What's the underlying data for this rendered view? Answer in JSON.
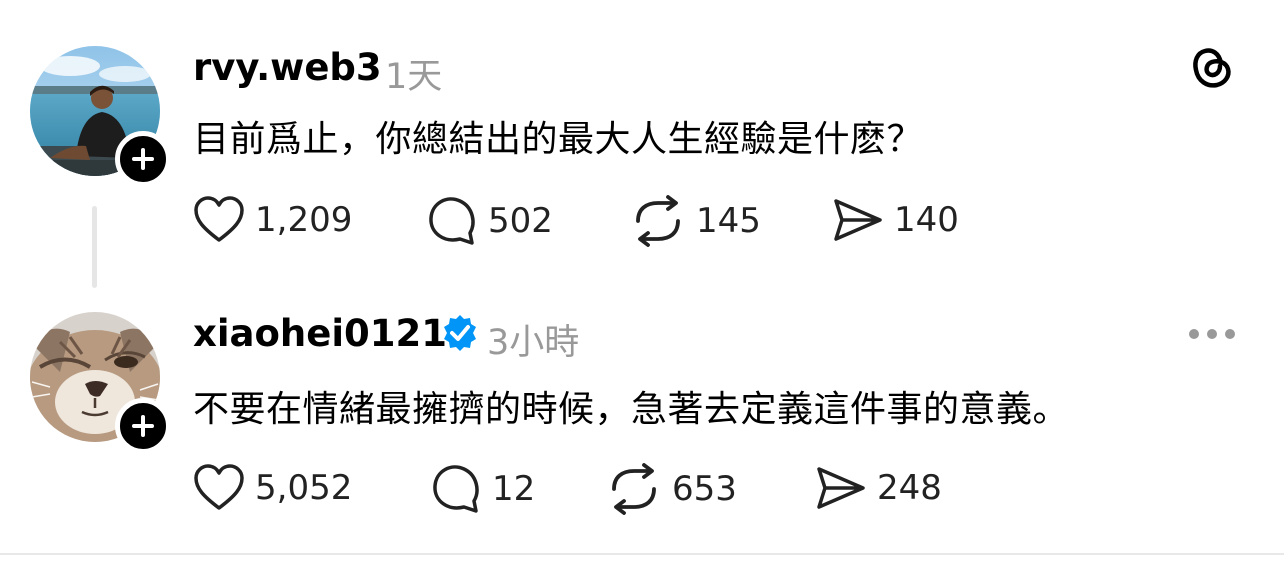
{
  "posts": [
    {
      "username": "rvy.web3",
      "time": "1天",
      "text": "目前爲止，你總結出的最大人生經驗是什麽？",
      "likes": "1,209",
      "replies": "502",
      "reposts": "145",
      "shares": "140"
    },
    {
      "username": "xiaohei0121",
      "verified": true,
      "time": "3小時",
      "text": "不要在情緒最擁擠的時候，急著去定義這件事的意義。",
      "likes": "5,052",
      "replies": "12",
      "reposts": "653",
      "shares": "248"
    }
  ],
  "icons": {
    "app_logo": "threads-logo-icon",
    "like": "heart-icon",
    "reply": "comment-icon",
    "repost": "repost-icon",
    "share": "send-icon",
    "more": "more-options-icon",
    "follow": "plus-icon"
  },
  "colors": {
    "verified": "#0095f6",
    "muted": "#999999",
    "text": "#000000"
  }
}
